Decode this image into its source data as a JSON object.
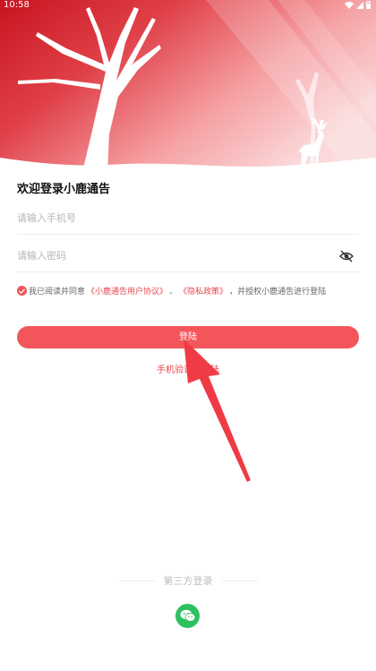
{
  "status_bar": {
    "time": "10:58"
  },
  "login": {
    "welcome_title": "欢迎登录小鹿通告",
    "phone_placeholder": "请输入手机号",
    "password_placeholder": "请输入密码",
    "agreement_prefix": "我已阅读并同意",
    "user_agreement": "《小鹿通告用户协议》",
    "separator": "、",
    "privacy_policy": "《隐私政策》",
    "agreement_suffix": "，并授权小鹿通告进行登陆",
    "login_button": "登陆",
    "sms_login_link": "手机验证码登陆",
    "third_party_title": "第三方登录"
  },
  "icons": {
    "visibility_toggle": "eye-off-icon",
    "wechat": "wechat-icon",
    "deer": "deer-icon"
  },
  "colors": {
    "accent": "#f2565a",
    "link": "#e8474c",
    "wechat": "#2dc160",
    "hero_red": "#d81e28"
  }
}
